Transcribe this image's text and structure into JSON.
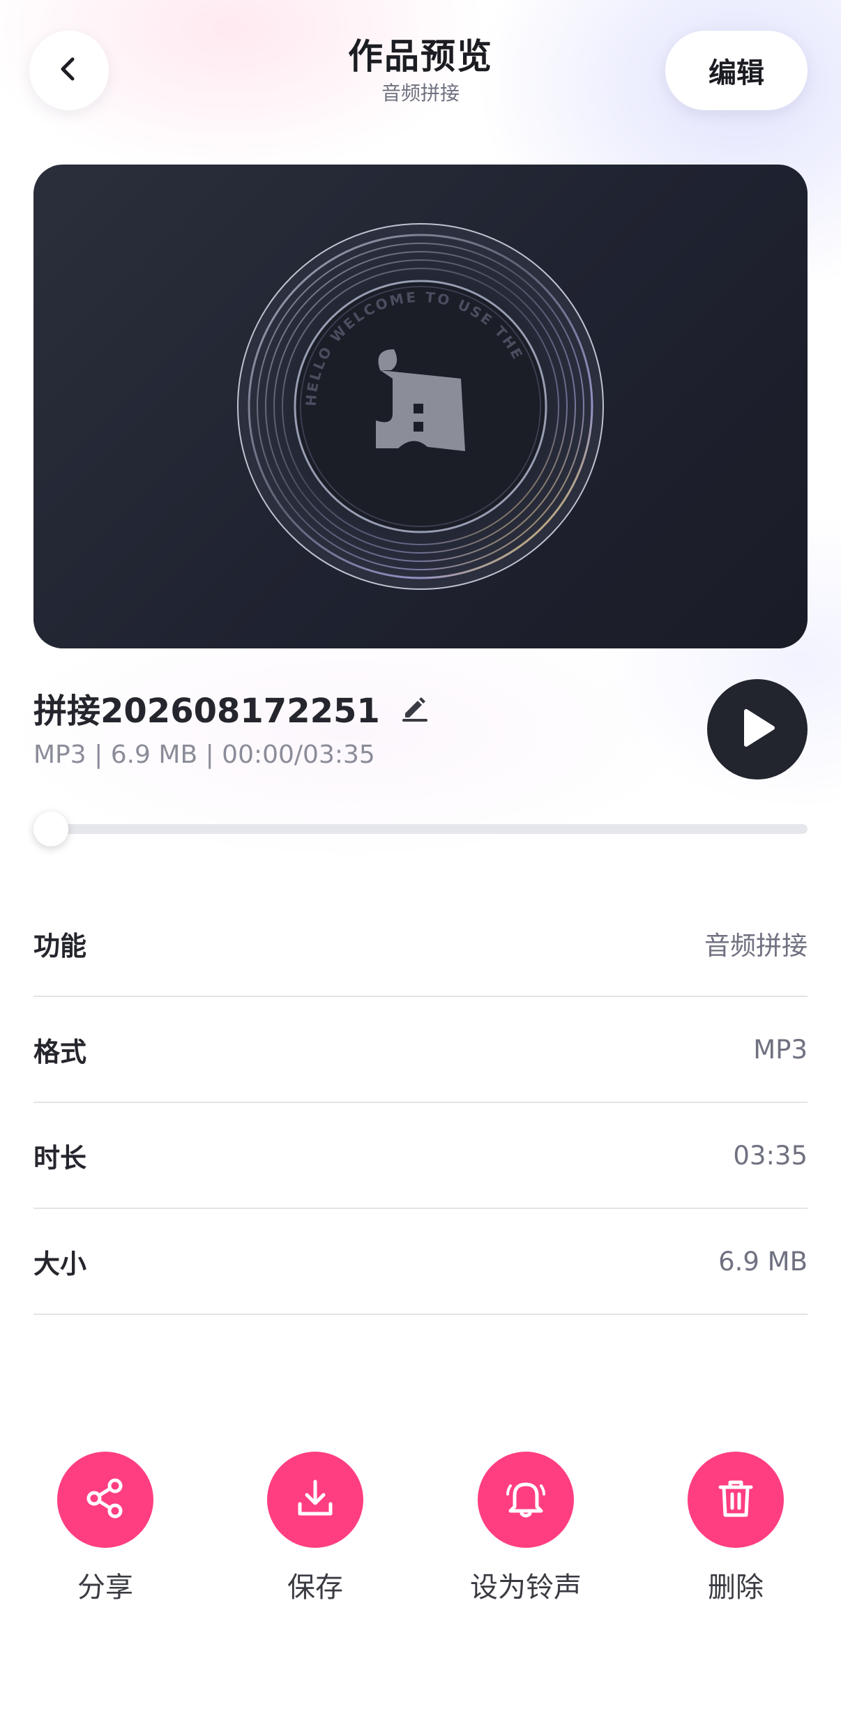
{
  "header": {
    "title": "作品预览",
    "subtitle": "音频拼接",
    "edit_label": "编辑"
  },
  "cover": {
    "icon": "vinyl-disc-artwork",
    "ring_text": "HELLO WELCOME TO USE THE"
  },
  "track": {
    "name": "拼接202608172251",
    "meta": "MP3 | 6.9 MB | 00:00/03:35",
    "progress": 0
  },
  "info": [
    {
      "label": "功能",
      "value": "音频拼接"
    },
    {
      "label": "格式",
      "value": "MP3"
    },
    {
      "label": "时长",
      "value": "03:35"
    },
    {
      "label": "大小",
      "value": "6.9 MB"
    }
  ],
  "actions": [
    {
      "label": "分享",
      "icon": "share-icon"
    },
    {
      "label": "保存",
      "icon": "download-icon"
    },
    {
      "label": "设为铃声",
      "icon": "bell-icon"
    },
    {
      "label": "删除",
      "icon": "trash-icon"
    }
  ],
  "colors": {
    "accent": "#ff3e82",
    "dark": "#22252e"
  }
}
